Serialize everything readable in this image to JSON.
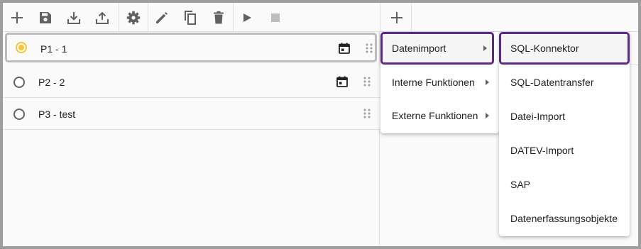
{
  "toolbar": {
    "icons": [
      "add-icon",
      "save-icon",
      "download-icon",
      "upload-icon",
      "gear-icon",
      "pencil-icon",
      "copy-icon",
      "trash-icon",
      "play-icon",
      "stop-icon"
    ]
  },
  "processes": [
    {
      "label": "P1 - 1",
      "selected": true,
      "has_calendar": true
    },
    {
      "label": "P2 - 2",
      "selected": false,
      "has_calendar": true
    },
    {
      "label": "P3 - test",
      "selected": false,
      "has_calendar": false
    }
  ],
  "main_menu": {
    "items": [
      {
        "label": "Datenimport",
        "has_submenu": true,
        "highlighted": true
      },
      {
        "label": "Interne Funktionen",
        "has_submenu": true,
        "highlighted": false
      },
      {
        "label": "Externe Funktionen",
        "has_submenu": true,
        "highlighted": false
      }
    ]
  },
  "sub_menu": {
    "items": [
      {
        "label": "SQL-Konnektor",
        "highlighted": true
      },
      {
        "label": "SQL-Datentransfer",
        "highlighted": false
      },
      {
        "label": "Datei-Import",
        "highlighted": false
      },
      {
        "label": "DATEV-Import",
        "highlighted": false
      },
      {
        "label": "SAP",
        "highlighted": false
      },
      {
        "label": "Datenerfassungsobjekte",
        "highlighted": false
      }
    ]
  },
  "colors": {
    "accent": "#5b2b83",
    "radio_selected": "#f9c43a",
    "icon": "#616161",
    "icon_disabled": "#bdbdbd"
  }
}
